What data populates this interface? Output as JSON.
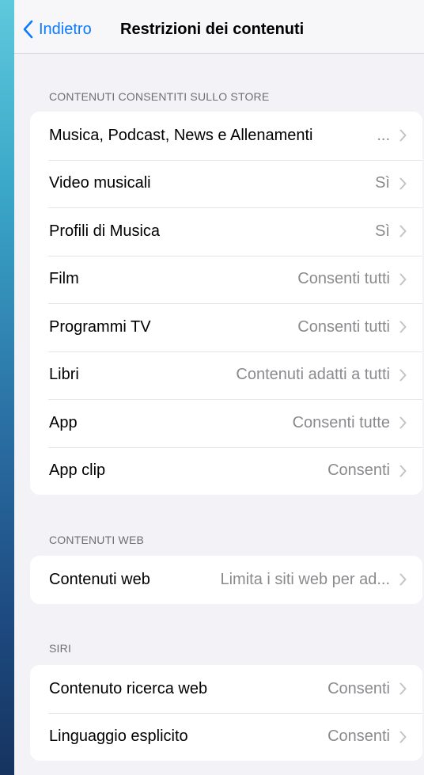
{
  "nav": {
    "back_label": "Indietro",
    "title": "Restrizioni dei contenuti"
  },
  "sections": {
    "store": {
      "header": "CONTENUTI CONSENTITI SULLO STORE",
      "rows": [
        {
          "label": "Musica, Podcast, News e Allenamenti",
          "value": "..."
        },
        {
          "label": "Video musicali",
          "value": "Sì"
        },
        {
          "label": "Profili di Musica",
          "value": "Sì"
        },
        {
          "label": "Film",
          "value": "Consenti tutti"
        },
        {
          "label": "Programmi TV",
          "value": "Consenti tutti"
        },
        {
          "label": "Libri",
          "value": "Contenuti adatti a tutti"
        },
        {
          "label": "App",
          "value": "Consenti tutte"
        },
        {
          "label": "App clip",
          "value": "Consenti"
        }
      ]
    },
    "web": {
      "header": "CONTENUTI WEB",
      "rows": [
        {
          "label": "Contenuti web",
          "value": "Limita i siti web per ad..."
        }
      ]
    },
    "siri": {
      "header": "SIRI",
      "rows": [
        {
          "label": "Contenuto ricerca web",
          "value": "Consenti"
        },
        {
          "label": "Linguaggio esplicito",
          "value": "Consenti"
        }
      ]
    }
  },
  "icons": {
    "back": "chevron-left-icon",
    "disclosure": "chevron-right-icon"
  },
  "colors": {
    "accent": "#0a7aff",
    "secondary_text": "#8a8a8e",
    "grouped_background": "#f2f2f7",
    "cell_background": "#ffffff"
  }
}
